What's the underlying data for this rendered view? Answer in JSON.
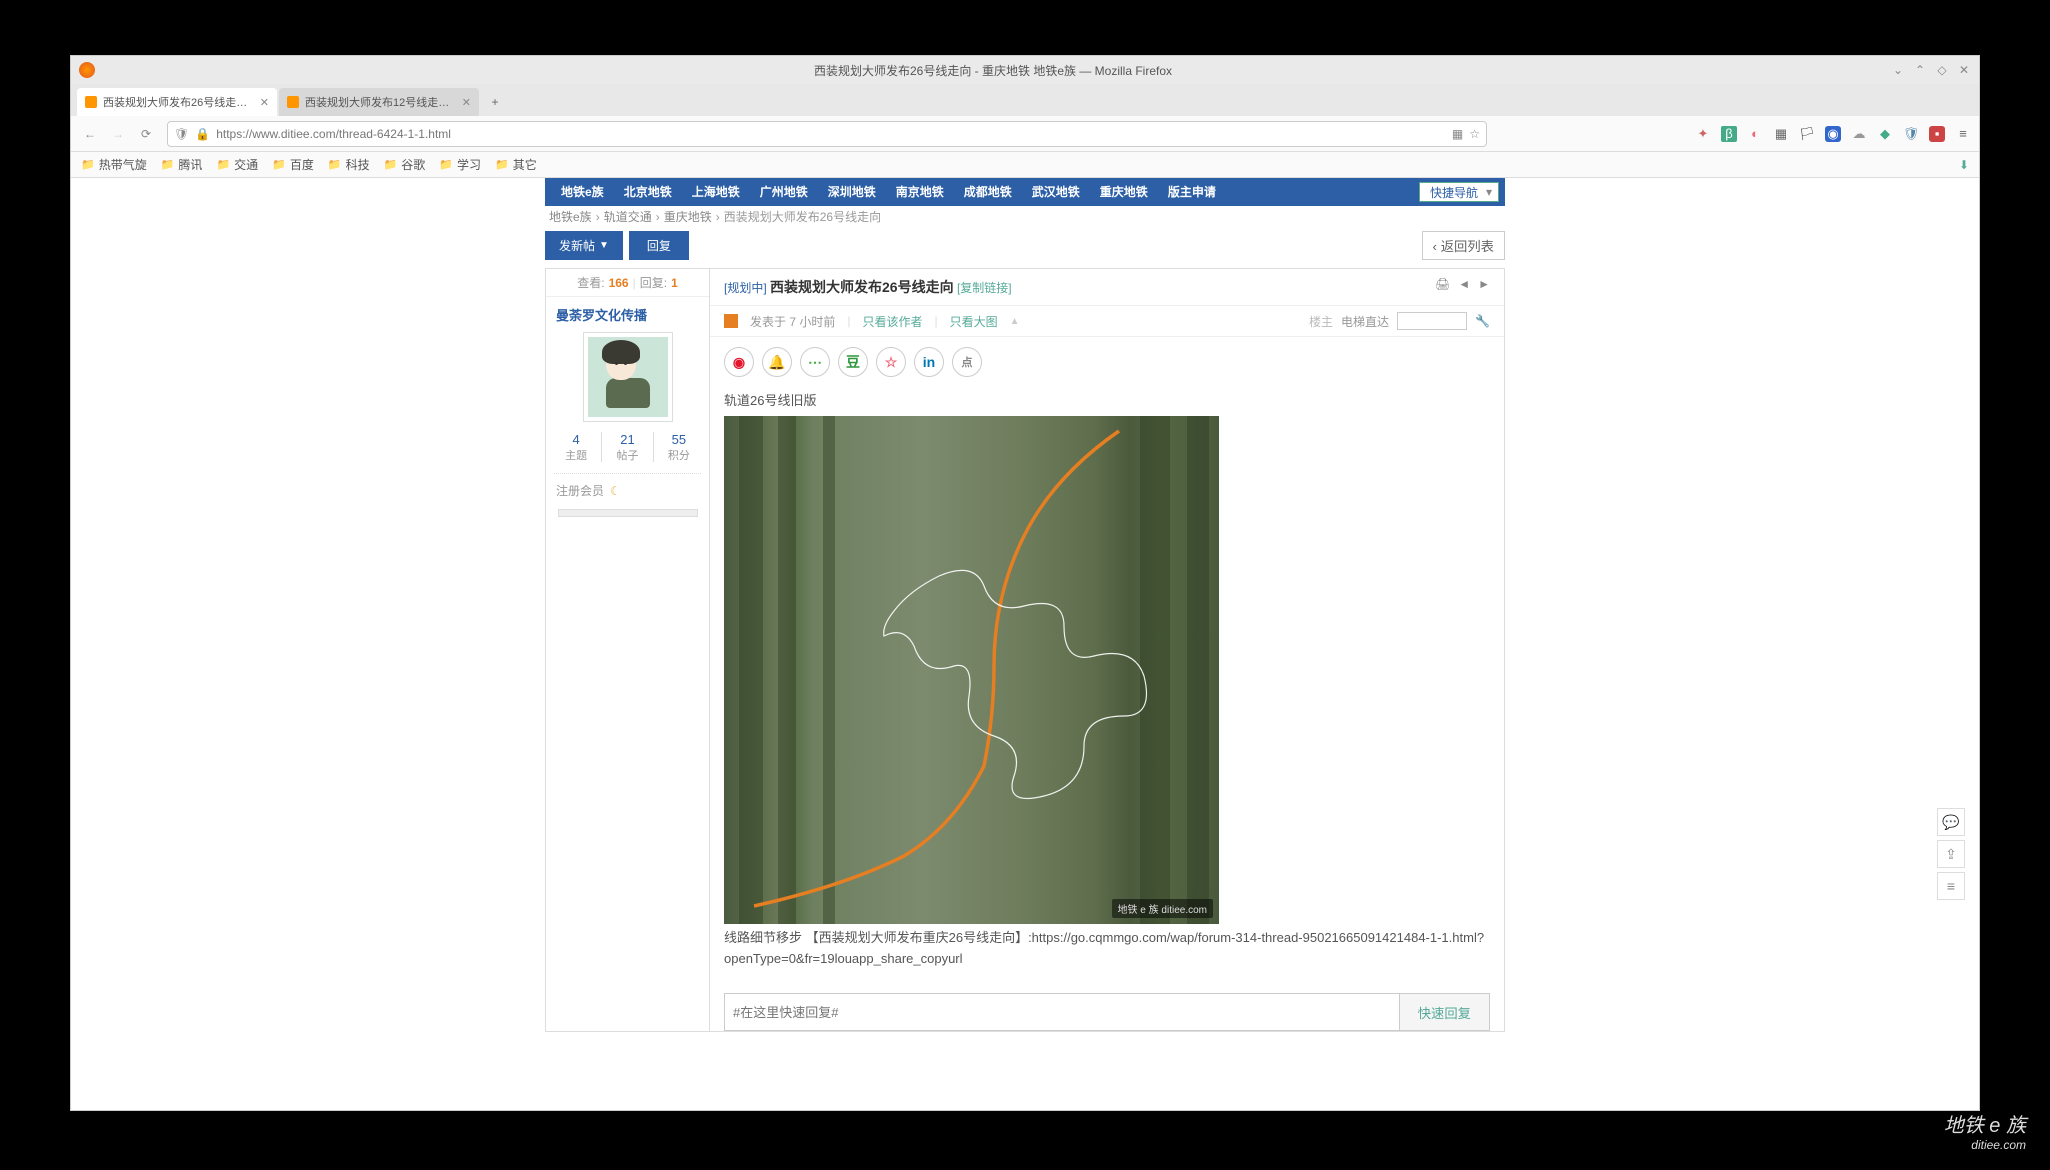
{
  "window": {
    "title": "西装规划大师发布26号线走向 - 重庆地铁 地铁e族 — Mozilla Firefox"
  },
  "tabs": [
    {
      "label": "西装规划大师发布26号线走…",
      "active": true
    },
    {
      "label": "西装规划大师发布12号线走…",
      "active": false
    }
  ],
  "url": "https://www.ditiee.com/thread-6424-1-1.html",
  "bookmarks": [
    "热带气旋",
    "腾讯",
    "交通",
    "百度",
    "科技",
    "谷歌",
    "学习",
    "其它"
  ],
  "topnav": [
    "地铁e族",
    "北京地铁",
    "上海地铁",
    "广州地铁",
    "深圳地铁",
    "南京地铁",
    "成都地铁",
    "武汉地铁",
    "重庆地铁",
    "版主申请"
  ],
  "quicknav_label": "快捷导航",
  "breadcrumb": [
    "地铁e族",
    "轨道交通",
    "重庆地铁",
    "西装规划大师发布26号线走向"
  ],
  "buttons": {
    "newpost": "发新帖",
    "reply": "回复",
    "return_list": "返回列表"
  },
  "stats": {
    "view_label": "查看:",
    "view_count": "166",
    "reply_label": "回复:",
    "reply_count": "1"
  },
  "user": {
    "name": "曼荼罗文化传播",
    "threads_n": "4",
    "threads_l": "主题",
    "posts_n": "21",
    "posts_l": "帖子",
    "points_n": "55",
    "points_l": "积分",
    "level": "注册会员"
  },
  "post": {
    "tag": "[规划中]",
    "title": "西装规划大师发布26号线走向",
    "copy_link": "[复制链接]",
    "meta_publish": "发表于 7 小时前",
    "only_author": "只看该作者",
    "only_big": "只看大图",
    "floor_label": "楼主",
    "elevator_label": "电梯直达",
    "body_line1": "轨道26号线旧版",
    "body_line2": "线路细节移步 【西装规划大师发布重庆26号线走向】:https://go.cqmmgo.com/wap/forum-314-thread-95021665091421484-1-1.html?openType=0&fr=19louapp_share_copyurl",
    "map_watermark": "地铁 e 族\nditiee.com"
  },
  "reply_box": {
    "placeholder": "#在这里快速回复#",
    "button": "快速回复"
  },
  "watermark": {
    "line1": "地铁 e 族",
    "line2": "ditiee.com"
  }
}
